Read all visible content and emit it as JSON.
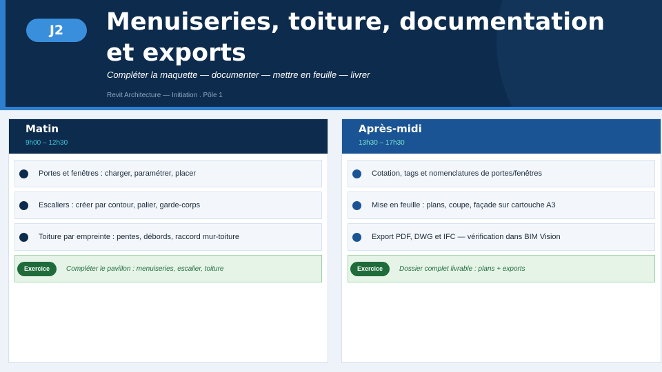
{
  "header": {
    "day_badge": "J2",
    "title": "Menuiseries, toiture, documentation et exports",
    "subtitle": "Compléter la maquette — documenter — mettre en feuille — livrer",
    "meta": "Revit Architecture — Initiation . Pôle 1"
  },
  "morning": {
    "title": "Matin",
    "time": "9h00 – 12h30",
    "items": [
      "Portes et fenêtres : charger, paramétrer, placer",
      "Escaliers : créer par contour, palier, garde-corps",
      "Toiture par empreinte : pentes, débords, raccord mur-toiture"
    ],
    "exercise_label": "Exercice",
    "exercise_text": "Compléter le pavillon : menuiseries, escalier, toiture"
  },
  "afternoon": {
    "title": "Après-midi",
    "time": "13h30 – 17h30",
    "items": [
      "Cotation, tags et nomenclatures de portes/fenêtres",
      "Mise en feuille : plans, coupe, façade sur cartouche A3",
      "Export PDF, DWG et IFC — vérification dans BIM Vision"
    ],
    "exercise_label": "Exercice",
    "exercise_text": "Dossier complet livrable : plans + exports"
  },
  "colors": {
    "header_bg": "#0d2b4c",
    "accent": "#2e7fcf",
    "afternoon_header": "#1a5494",
    "exercise_green": "#1f6b3a"
  }
}
